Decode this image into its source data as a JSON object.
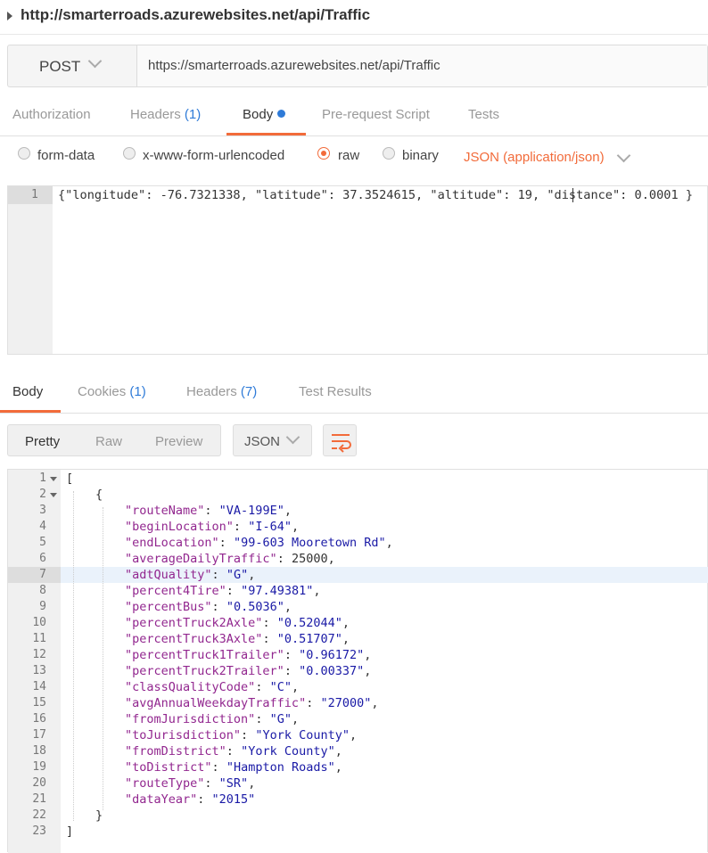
{
  "top": {
    "title": "http://smarterroads.azurewebsites.net/api/Traffic"
  },
  "request": {
    "method": "POST",
    "url": "https://smarterroads.azurewebsites.net/api/Traffic"
  },
  "req_tabs": [
    {
      "label": "Authorization"
    },
    {
      "label": "Headers",
      "count": "(1)"
    },
    {
      "label": "Body"
    },
    {
      "label": "Pre-request Script"
    },
    {
      "label": "Tests"
    }
  ],
  "body_types": {
    "options": [
      "form-data",
      "x-www-form-urlencoded",
      "raw",
      "binary"
    ],
    "selected": "raw",
    "content_type": "JSON (application/json)"
  },
  "editor": {
    "line_number": "1",
    "code": "{\"longitude\": -76.7321338, \"latitude\": 37.3524615, \"altitude\": 19, \"distance\": 0.0001 }"
  },
  "resp_tabs": [
    {
      "label": "Body"
    },
    {
      "label": "Cookies",
      "count": "(1)"
    },
    {
      "label": "Headers",
      "count": "(7)"
    },
    {
      "label": "Test Results"
    }
  ],
  "view_modes": [
    "Pretty",
    "Raw",
    "Preview"
  ],
  "format": "JSON",
  "response_lines": [
    {
      "n": "1",
      "fold": true,
      "indent": 0,
      "text": "["
    },
    {
      "n": "2",
      "fold": true,
      "indent": 1,
      "text": "{"
    },
    {
      "n": "3",
      "indent": 2,
      "key": "\"routeName\"",
      "val": "\"VA-199E\"",
      "str": true
    },
    {
      "n": "4",
      "indent": 2,
      "key": "\"beginLocation\"",
      "val": "\"I-64\"",
      "str": true
    },
    {
      "n": "5",
      "indent": 2,
      "key": "\"endLocation\"",
      "val": "\"99-603 Mooretown Rd\"",
      "str": true
    },
    {
      "n": "6",
      "indent": 2,
      "key": "\"averageDailyTraffic\"",
      "val": "25000",
      "str": false
    },
    {
      "n": "7",
      "indent": 2,
      "key": "\"adtQuality\"",
      "val": "\"G\"",
      "str": true
    },
    {
      "n": "8",
      "indent": 2,
      "key": "\"percent4Tire\"",
      "val": "\"97.49381\"",
      "str": true
    },
    {
      "n": "9",
      "indent": 2,
      "key": "\"percentBus\"",
      "val": "\"0.5036\"",
      "str": true
    },
    {
      "n": "10",
      "indent": 2,
      "key": "\"percentTruck2Axle\"",
      "val": "\"0.52044\"",
      "str": true
    },
    {
      "n": "11",
      "indent": 2,
      "key": "\"percentTruck3Axle\"",
      "val": "\"0.51707\"",
      "str": true
    },
    {
      "n": "12",
      "indent": 2,
      "key": "\"percentTruck1Trailer\"",
      "val": "\"0.96172\"",
      "str": true
    },
    {
      "n": "13",
      "indent": 2,
      "key": "\"percentTruck2Trailer\"",
      "val": "\"0.00337\"",
      "str": true
    },
    {
      "n": "14",
      "indent": 2,
      "key": "\"classQualityCode\"",
      "val": "\"C\"",
      "str": true
    },
    {
      "n": "15",
      "indent": 2,
      "key": "\"avgAnnualWeekdayTraffic\"",
      "val": "\"27000\"",
      "str": true
    },
    {
      "n": "16",
      "indent": 2,
      "key": "\"fromJurisdiction\"",
      "val": "\"G\"",
      "str": true
    },
    {
      "n": "17",
      "indent": 2,
      "key": "\"toJurisdiction\"",
      "val": "\"York County\"",
      "str": true
    },
    {
      "n": "18",
      "indent": 2,
      "key": "\"fromDistrict\"",
      "val": "\"York County\"",
      "str": true
    },
    {
      "n": "19",
      "indent": 2,
      "key": "\"toDistrict\"",
      "val": "\"Hampton Roads\"",
      "str": true
    },
    {
      "n": "20",
      "indent": 2,
      "key": "\"routeType\"",
      "val": "\"SR\"",
      "str": true
    },
    {
      "n": "21",
      "indent": 2,
      "key": "\"dataYear\"",
      "val": "\"2015\"",
      "str": true,
      "last": true
    },
    {
      "n": "22",
      "indent": 1,
      "text": "}"
    },
    {
      "n": "23",
      "indent": 0,
      "text": "]"
    }
  ],
  "colors": {
    "accent": "#f26b3a",
    "link_blue": "#2f7bd8",
    "json_key": "#92278f",
    "json_string": "#1a1aa6"
  }
}
